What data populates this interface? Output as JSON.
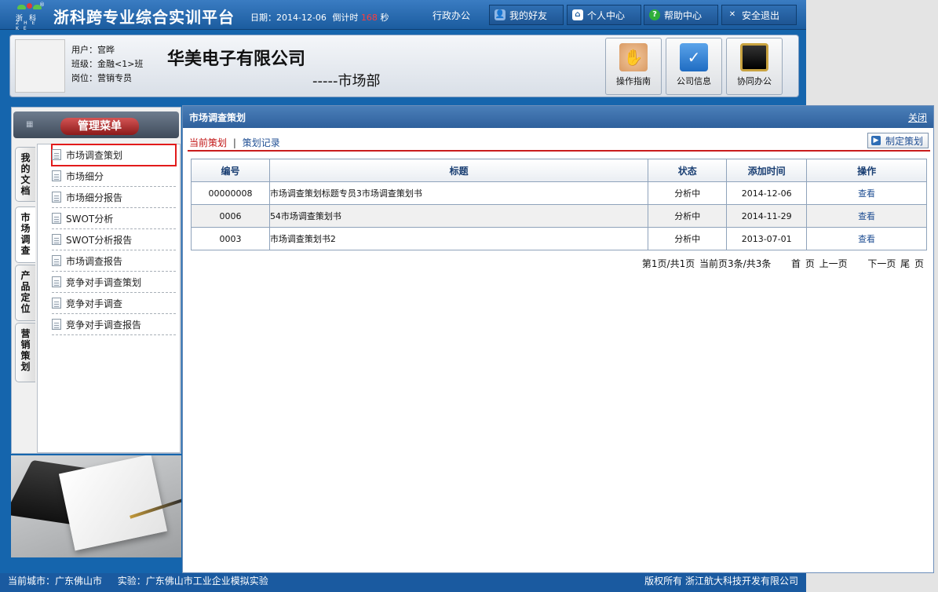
{
  "header": {
    "logo": {
      "cn": "浙科",
      "en": "ZHE KE",
      "reg": "®"
    },
    "app_title": "浙科跨专业综合实训平台",
    "date_label": "日期：",
    "date_value": "2014-12-06",
    "countdown_label": "倒计时",
    "countdown_value": "168",
    "countdown_unit": "秒",
    "dept_link": "行政办公",
    "buttons": [
      {
        "label": "我的好友",
        "icon": "friends-icon"
      },
      {
        "label": "个人中心",
        "icon": "home-icon"
      },
      {
        "label": "帮助中心",
        "icon": "help-icon"
      },
      {
        "label": "安全退出",
        "icon": "close-icon"
      }
    ]
  },
  "info": {
    "user_label": "用户：",
    "user_value": "宫晔",
    "class_label": "班级：",
    "class_value": "金融<1>班",
    "post_label": "岗位：",
    "post_value": "营销专员",
    "company": "华美电子有限公司",
    "department": "-----市场部",
    "buttons": [
      {
        "label": "操作指南"
      },
      {
        "label": "公司信息"
      },
      {
        "label": "协同办公"
      }
    ]
  },
  "sidebar": {
    "title": "管理菜单",
    "tabs": [
      "我的文档",
      "市场调查",
      "产品定位",
      "营销策划"
    ],
    "active_tab": 1,
    "items": [
      "市场调查策划",
      "市场细分",
      "市场细分报告",
      "SWOT分析",
      "SWOT分析报告",
      "市场调查报告",
      "竞争对手调查策划",
      "竞争对手调查",
      "竞争对手调查报告"
    ],
    "selected_item": 0
  },
  "content": {
    "title": "市场调查策划",
    "close_label": "关闭",
    "subtab_current": "当前策划",
    "subtab_separator": "|",
    "subtab_history": "策划记录",
    "create_button": "制定策划",
    "columns": [
      "编号",
      "标题",
      "状态",
      "添加时间",
      "操作"
    ],
    "rows": [
      {
        "id": "00000008",
        "title": "市场调查策划标题专员3市场调查策划书",
        "status": "分析中",
        "added": "2014-12-06",
        "action": "查看"
      },
      {
        "id": "0006",
        "title": "54市场调查策划书",
        "status": "分析中",
        "added": "2014-11-29",
        "action": "查看"
      },
      {
        "id": "0003",
        "title": "市场调查策划书2",
        "status": "分析中",
        "added": "2013-07-01",
        "action": "查看"
      }
    ],
    "pager": {
      "info": "第1页/共1页 当前页3条/共3条",
      "first": "首 页",
      "prev": "上一页",
      "next": "下一页",
      "last": "尾 页"
    }
  },
  "footer": {
    "city_label": "当前城市：",
    "city_value": "广东佛山市",
    "experiment_label": "实验：",
    "experiment_value": "广东佛山市工业企业模拟实验",
    "copyright": "版权所有 浙江航大科技开发有限公司"
  },
  "colors": {
    "brand_blue": "#1565ad",
    "accent_red": "#c91d1d",
    "link_blue": "#1f4e93"
  }
}
